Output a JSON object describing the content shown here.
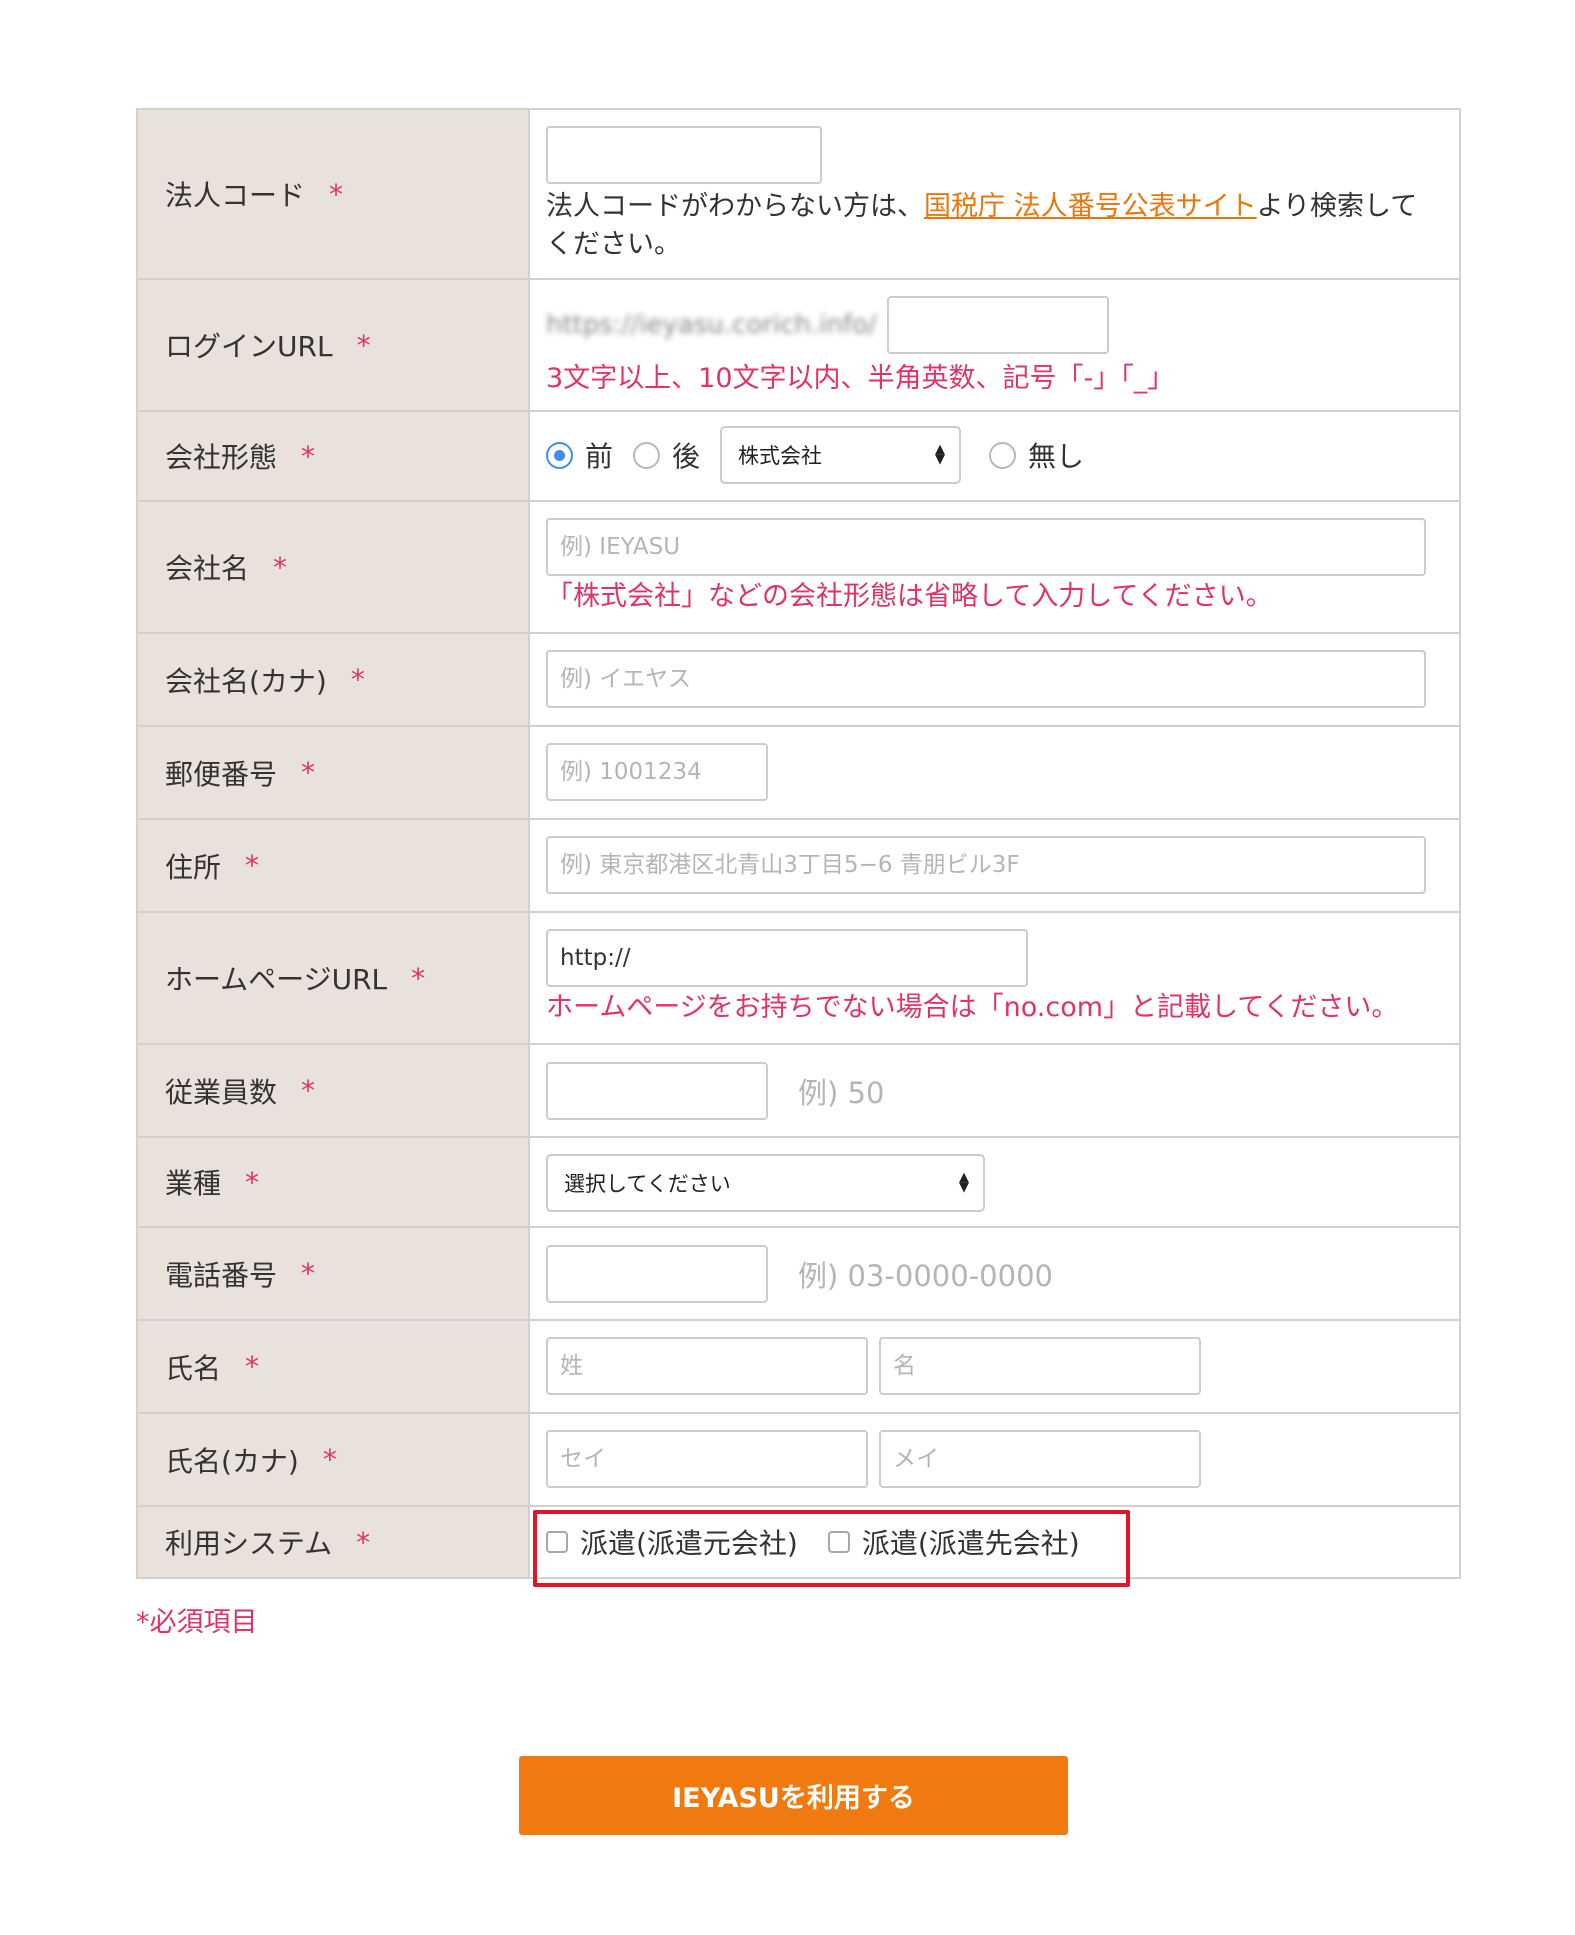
{
  "required_mark": "*",
  "rows": {
    "corp_code": {
      "label": "法人コード",
      "help_before": "法人コードがわからない方は、",
      "help_link": "国税庁 法人番号公表サイト",
      "help_after": "より検索してください。"
    },
    "login_url": {
      "label": "ログインURL",
      "url_prefix": "https://ieyasu.corich.info/",
      "note": "3文字以上、10文字以内、半角英数、記号「-」「_」"
    },
    "company_form": {
      "label": "会社形態",
      "options": [
        "前",
        "後"
      ],
      "selected": "前",
      "select_value": "株式会社",
      "none_option": "無し"
    },
    "company_name": {
      "label": "会社名",
      "placeholder": "例) IEYASU",
      "note": "「株式会社」などの会社形態は省略して入力してください。"
    },
    "company_kana": {
      "label": "会社名(カナ)",
      "placeholder": "例) イエヤス"
    },
    "postal": {
      "label": "郵便番号",
      "placeholder": "例) 1001234"
    },
    "address": {
      "label": "住所",
      "placeholder": "例) 東京都港区北青山3丁目5−6 青朋ビル3F"
    },
    "homepage": {
      "label": "ホームページURL",
      "value": "http://",
      "note": "ホームページをお持ちでない場合は「no.com」と記載してください。"
    },
    "employees": {
      "label": "従業員数",
      "example": "例) 50"
    },
    "industry": {
      "label": "業種",
      "select_value": "選択してください"
    },
    "phone": {
      "label": "電話番号",
      "example": "例) 03-0000-0000"
    },
    "name": {
      "label": "氏名",
      "last_placeholder": "姓",
      "first_placeholder": "名"
    },
    "name_kana": {
      "label": "氏名(カナ)",
      "last_placeholder": "セイ",
      "first_placeholder": "メイ"
    },
    "system": {
      "label": "利用システム",
      "options": [
        "派遣(派遣元会社)",
        "派遣(派遣先会社)"
      ]
    }
  },
  "required_note": "*必須項目",
  "submit_label": "IEYASUを利用する",
  "colors": {
    "accent": "#f07a10",
    "required": "#e0336a",
    "header_bg": "#e8e1dc",
    "highlight": "#e0142a",
    "radio": "#3d8fe8"
  }
}
